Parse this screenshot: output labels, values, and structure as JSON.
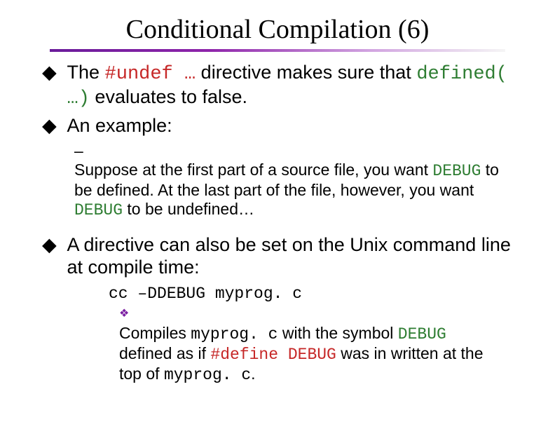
{
  "title": "Conditional Compilation (6)",
  "bullets": {
    "p1_prefix": "The ",
    "p1_undef": "#undef …",
    "p1_rest1": " directive makes sure that ",
    "p1_defined": "defined( …)",
    "p1_rest2": " evaluates to false.",
    "p2": "An example:",
    "p3_a": "Suppose at the first part of a source file, you want ",
    "p3_debug1": "DEBUG",
    "p3_b": " to be defined.  At the last part of the file, however, you want ",
    "p3_debug2": "DEBUG",
    "p3_c": " to be undefined…",
    "p4": "A directive can also be set on the Unix command line at compile time:",
    "p5": "cc –DDEBUG myprog. c",
    "p6_a": "Compiles ",
    "p6_my1": "myprog. c",
    "p6_b": " with the symbol ",
    "p6_debug": "DEBUG",
    "p6_c": " defined as if ",
    "p6_def": "#define DEBUG",
    "p6_d": " was in written at the top of ",
    "p6_my2": "myprog. c",
    "p6_e": "."
  }
}
